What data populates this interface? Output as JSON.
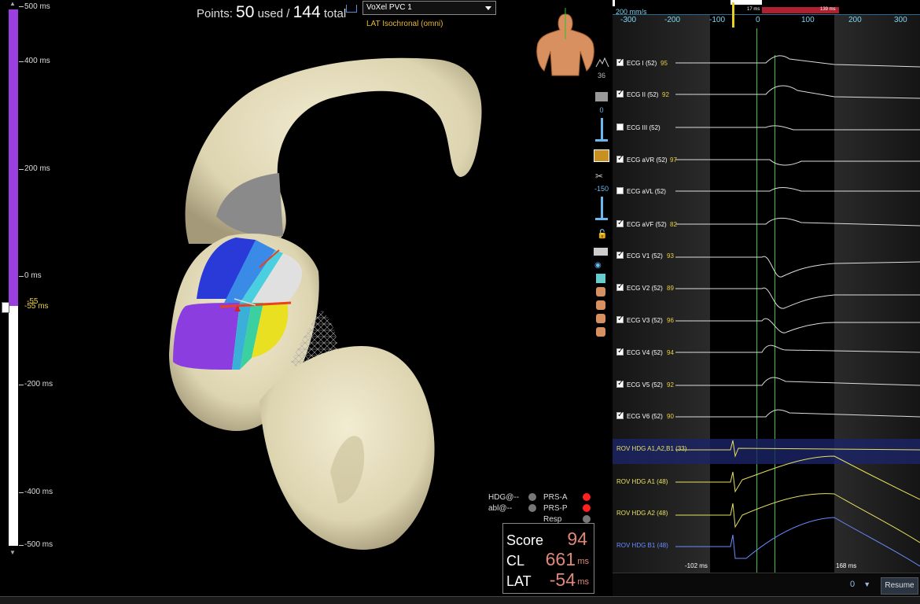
{
  "scale": {
    "ticks": [
      "500 ms",
      "400 ms",
      "200 ms",
      "0 ms",
      "-55 ms",
      "-200 ms",
      "-400 ms",
      "-500 ms"
    ],
    "marker_label": "-55",
    "colors": {
      "top": "#9b3fe0",
      "bottom": "#ffffff"
    }
  },
  "header": {
    "points_prefix": "Points:",
    "points_used": "50",
    "points_used_label": "used /",
    "points_total": "144",
    "points_total_label": "total",
    "map_name": "VoXel PVC 1",
    "map_type": "LAT Isochronal (omni)"
  },
  "toolbar": {
    "values": [
      "36",
      "0",
      "-150"
    ]
  },
  "legend": {
    "left_items": [
      "HDG@--",
      "abl@--"
    ],
    "right_items": [
      "PRS-A",
      "PRS-P",
      "Resp"
    ],
    "right_colors": [
      "#ff2020",
      "#ff2020",
      "#777777"
    ]
  },
  "score": {
    "score_label": "Score",
    "score_value": "94",
    "cl_label": "CL",
    "cl_value": "661",
    "cl_unit": "ms",
    "lat_label": "LAT",
    "lat_value": "-54",
    "lat_unit": "ms"
  },
  "ecg": {
    "speed": "200 mm/s",
    "axis_ticks": [
      "-300",
      "-200",
      "-100",
      "0",
      "100",
      "200",
      "300"
    ],
    "window_left": "17 ms",
    "window_right": "139 ms",
    "leads": [
      {
        "label": "ECG I (52)",
        "num": "95",
        "checked": true
      },
      {
        "label": "ECG II (52)",
        "num": "92",
        "checked": true
      },
      {
        "label": "ECG III (52)",
        "num": "",
        "checked": false
      },
      {
        "label": "ECG aVR (52)",
        "num": "97",
        "checked": true
      },
      {
        "label": "ECG aVL (52)",
        "num": "",
        "checked": false
      },
      {
        "label": "ECG aVF (52)",
        "num": "82",
        "checked": true
      },
      {
        "label": "ECG V1 (52)",
        "num": "93",
        "checked": true
      },
      {
        "label": "ECG V2 (52)",
        "num": "89",
        "checked": true
      },
      {
        "label": "ECG V3 (52)",
        "num": "96",
        "checked": true
      },
      {
        "label": "ECG V4 (52)",
        "num": "94",
        "checked": true
      },
      {
        "label": "ECG V5 (52)",
        "num": "92",
        "checked": true
      },
      {
        "label": "ECG V6 (52)",
        "num": "90",
        "checked": true
      }
    ],
    "intracardiac": [
      {
        "label": "ROV HDG  A1,A2,B1 (33)",
        "color": "#e8e060"
      },
      {
        "label": "ROV HDG A1 (48)",
        "color": "#e8e060"
      },
      {
        "label": "ROV HDG A2 (48)",
        "color": "#e8e060"
      },
      {
        "label": "ROV HDG B1 (48)",
        "color": "#6a8cff"
      }
    ],
    "bottom_left_time": "-102 ms",
    "bottom_right_time": "168 ms",
    "speed_value": "0",
    "resume_label": "Resume"
  }
}
